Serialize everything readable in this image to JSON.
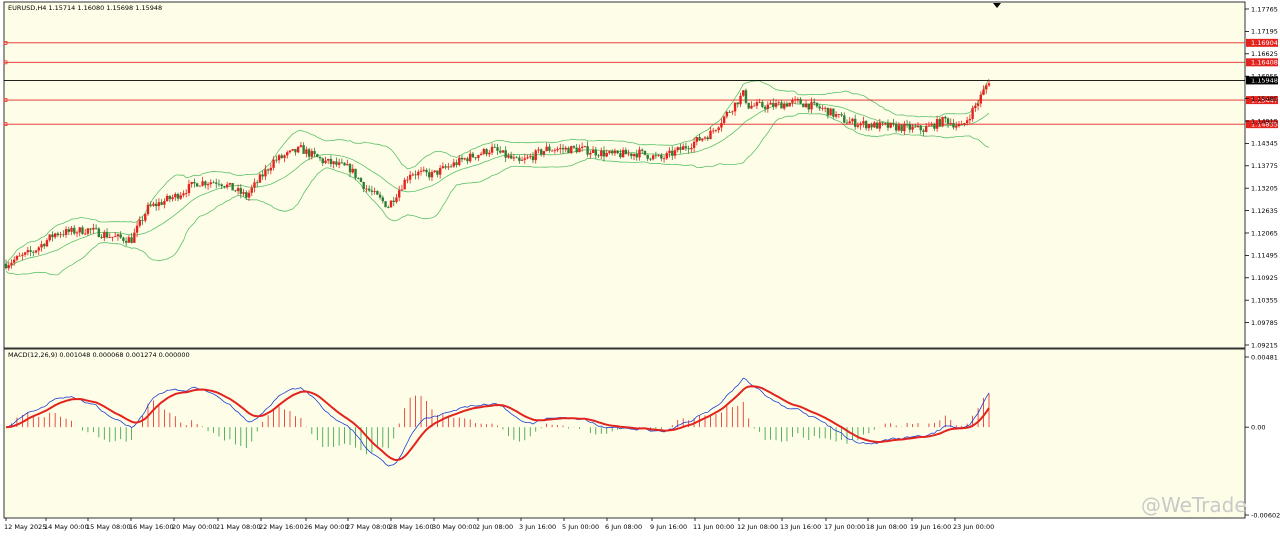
{
  "chart_data": [
    {
      "type": "candlestick",
      "title": "EURUSD,H4  1.15714 1.16080 1.15698 1.15948",
      "ylim": [
        1.09215,
        1.17765
      ],
      "y_ticks": [
        "1.17765",
        "1.17195",
        "1.16625",
        "1.16055",
        "1.15485",
        "1.14915",
        "1.14345",
        "1.13775",
        "1.13205",
        "1.12635",
        "1.12065",
        "1.11495",
        "1.10925",
        "1.10355",
        "1.09785",
        "1.09215"
      ],
      "last_price": "1.15948",
      "last_price_color": "#000000",
      "horizontal_levels": [
        {
          "value": 1.16904,
          "label": "1.16904",
          "color": "#e3231e"
        },
        {
          "value": 1.16408,
          "label": "1.16408",
          "color": "#e3231e"
        },
        {
          "value": 1.15447,
          "label": "1.15447",
          "color": "#e3231e"
        },
        {
          "value": 1.14835,
          "label": "1.14835",
          "color": "#e3231e"
        }
      ],
      "indicators": [
        "Bollinger Bands"
      ],
      "colors": {
        "bull": "#e3231e",
        "bear": "#2e7d32",
        "bands": "#5cc06a",
        "background": "#fefee8",
        "grid_axis": "#000000"
      }
    },
    {
      "type": "line",
      "title": "MACD(12,26,9) 0.001048 0.000068 0.001274 0.000000",
      "ylim": [
        -0.00602,
        0.00481
      ],
      "y_ticks": [
        "0.00481",
        "0.00",
        "-0.00602"
      ],
      "series": [],
      "colors": {
        "macd": "#1e3fd0",
        "signal": "#e3231e",
        "hist_pos": "#e3231e",
        "hist_neg": "#2e9d3a"
      }
    }
  ],
  "x_labels": [
    "12 May 2025",
    "14 May 00:00",
    "15 May 08:00",
    "16 May 16:00",
    "20 May 00:00",
    "21 May 08:00",
    "22 May 16:00",
    "26 May 00:00",
    "27 May 08:00",
    "28 May 16:00",
    "30 May 00:00",
    "2 Jun 08:00",
    "3 Jun 16:00",
    "5 Jun 00:00",
    "6 Jun 08:00",
    "9 Jun 16:00",
    "11 Jun 00:00",
    "12 Jun 08:00",
    "13 Jun 16:00",
    "17 Jun 00:00",
    "18 Jun 08:00",
    "19 Jun 16:00",
    "23 Jun 00:00"
  ],
  "watermark": "@WeTrade"
}
